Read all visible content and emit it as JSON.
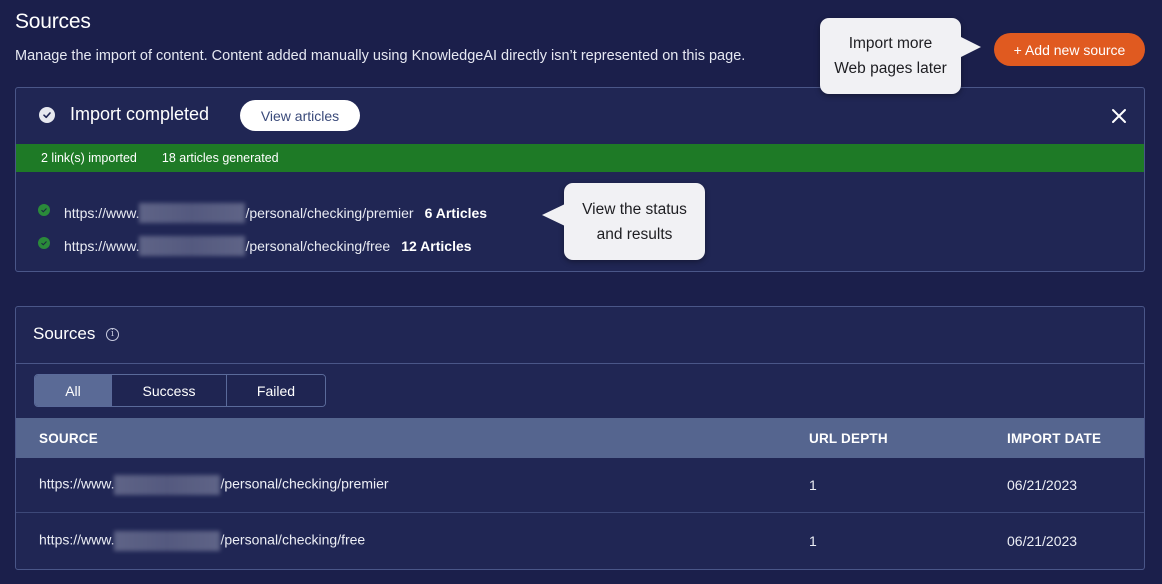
{
  "header": {
    "title": "Sources",
    "description": "Manage the import of content. Content added manually using KnowledgeAI directly isn’t represented on this page.",
    "add_button": "+ Add new source"
  },
  "callouts": {
    "add_source": [
      "Import more",
      "Web pages later"
    ],
    "status": [
      "View the status",
      "and results"
    ]
  },
  "import_panel": {
    "status_icon": "check-circle-icon",
    "title": "Import completed",
    "view_button": "View articles",
    "close_icon": "close-icon",
    "summary": {
      "links": "2 link(s) imported",
      "articles": "18 articles generated"
    },
    "results": [
      {
        "url_prefix": "https://www.",
        "url_path": "/personal/checking/premier",
        "count": "6 Articles"
      },
      {
        "url_prefix": "https://www.",
        "url_path": "/personal/checking/free",
        "count": "12 Articles"
      }
    ]
  },
  "sources_panel": {
    "title": "Sources",
    "info_icon": "info-icon",
    "filters": [
      "All",
      "Success",
      "Failed"
    ],
    "active_filter": "All",
    "columns": [
      "SOURCE",
      "URL DEPTH",
      "IMPORT DATE"
    ],
    "rows": [
      {
        "url_prefix": "https://www.",
        "url_path": "/personal/checking/premier",
        "depth": "1",
        "date": "06/21/2023"
      },
      {
        "url_prefix": "https://www.",
        "url_path": "/personal/checking/free",
        "depth": "1",
        "date": "06/21/2023"
      }
    ]
  },
  "colors": {
    "background": "#1b1f4b",
    "panel": "#202654",
    "accent_orange": "#e05a20",
    "success_green": "#1e7a26",
    "table_header": "#55658f"
  }
}
